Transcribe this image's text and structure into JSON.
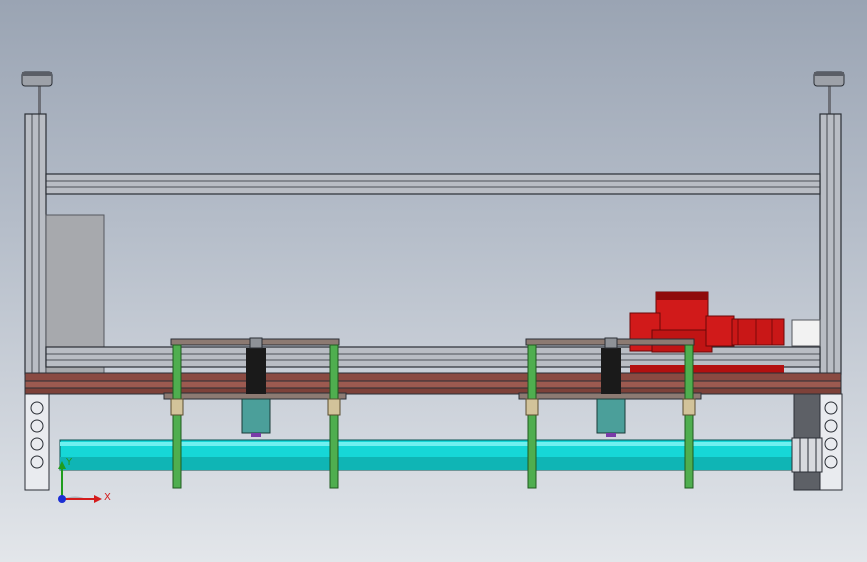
{
  "view": {
    "background_top": "#9aa4b3",
    "background_bottom": "#e3e6ea"
  },
  "colors": {
    "frame": "#b9bdc4",
    "frame_edge": "#2a2e35",
    "wood_plate": "#8a4a42",
    "shaft": "#16d7d7",
    "shaft_shadow": "#0aa0a0",
    "guide_rod": "#4fae4f",
    "bushing": "#d2c39a",
    "motor_red": "#d11a1a",
    "motor_red_dark": "#8f0b0b",
    "cylinder_teal": "#4b9f9a",
    "cylinder_dark": "#1a1a1a",
    "panel_gray": "#a7a9ad",
    "axis_x": "#d41c1c",
    "axis_y": "#1f9d1f",
    "axis_z": "#1c2fd4"
  },
  "triad": {
    "x_label": "X",
    "y_label": "Y"
  }
}
